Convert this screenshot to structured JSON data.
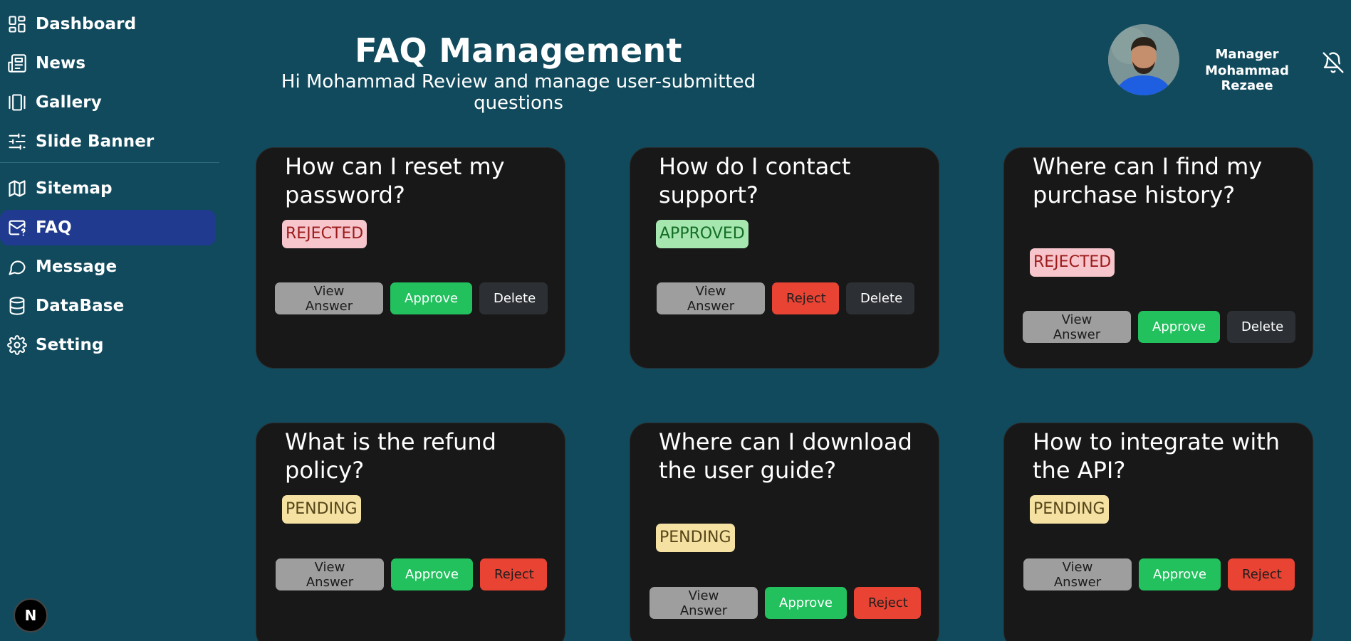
{
  "sidebar": {
    "items": [
      {
        "label": "Dashboard",
        "icon": "dashboard-icon",
        "active": false
      },
      {
        "label": "News",
        "icon": "newspaper-icon",
        "active": false
      },
      {
        "label": "Gallery",
        "icon": "gallery-icon",
        "active": false
      },
      {
        "label": "Slide Banner",
        "icon": "sliders-icon",
        "active": false
      },
      {
        "label": "Sitemap",
        "icon": "map-icon",
        "active": false
      },
      {
        "label": "FAQ",
        "icon": "mail-question-icon",
        "active": true
      },
      {
        "label": "Message",
        "icon": "chat-bubble-icon",
        "active": false
      },
      {
        "label": "DataBase",
        "icon": "database-icon",
        "active": false
      },
      {
        "label": "Setting",
        "icon": "gear-icon",
        "active": false
      }
    ],
    "next_badge": "N"
  },
  "header": {
    "title": "FAQ Management",
    "subtitle": "Hi Mohammad Review and manage user-submitted questions",
    "user_role": "Manager",
    "user_name": "Mohammad Rezaee"
  },
  "buttons": {
    "view_answer": "View Answer",
    "approve": "Approve",
    "reject": "Reject",
    "delete": "Delete"
  },
  "colors": {
    "background": "#114a5d",
    "active_nav": "#203a8f",
    "card": "#181818",
    "approve": "#22c15e",
    "reject": "#e84333"
  },
  "faqs": [
    {
      "question": "How can I reset my password?",
      "status": "REJECTED"
    },
    {
      "question": "How do I contact support?",
      "status": "APPROVED"
    },
    {
      "question": "Where can I find my purchase history?",
      "status": "REJECTED"
    },
    {
      "question": "What is the refund policy?",
      "status": "PENDING"
    },
    {
      "question": "Where can I download the user guide?",
      "status": "PENDING"
    },
    {
      "question": "How to integrate with the API?",
      "status": "PENDING"
    }
  ]
}
